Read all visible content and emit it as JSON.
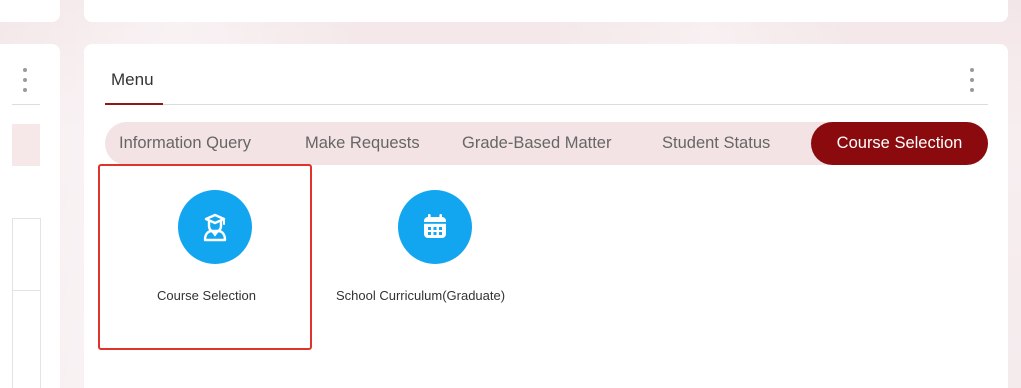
{
  "menu": {
    "title": "Menu",
    "more_icon": "more-vertical-icon"
  },
  "tabs": [
    {
      "label": "Information Query",
      "active": false
    },
    {
      "label": "Make Requests",
      "active": false
    },
    {
      "label": "Grade-Based Matter",
      "active": false
    },
    {
      "label": "Student Status",
      "active": false
    },
    {
      "label": "Course Selection",
      "active": true
    }
  ],
  "apps": [
    {
      "label": "Course Selection",
      "icon": "graduate-student-icon",
      "highlighted": true
    },
    {
      "label": "School Curriculum(Graduate)",
      "icon": "calendar-icon",
      "highlighted": false
    }
  ],
  "colors": {
    "accent": "#8b0a0e",
    "tab_bar_bg": "#f4e3e5",
    "icon_bg": "#13a6f0",
    "highlight_border": "#e0332d"
  }
}
